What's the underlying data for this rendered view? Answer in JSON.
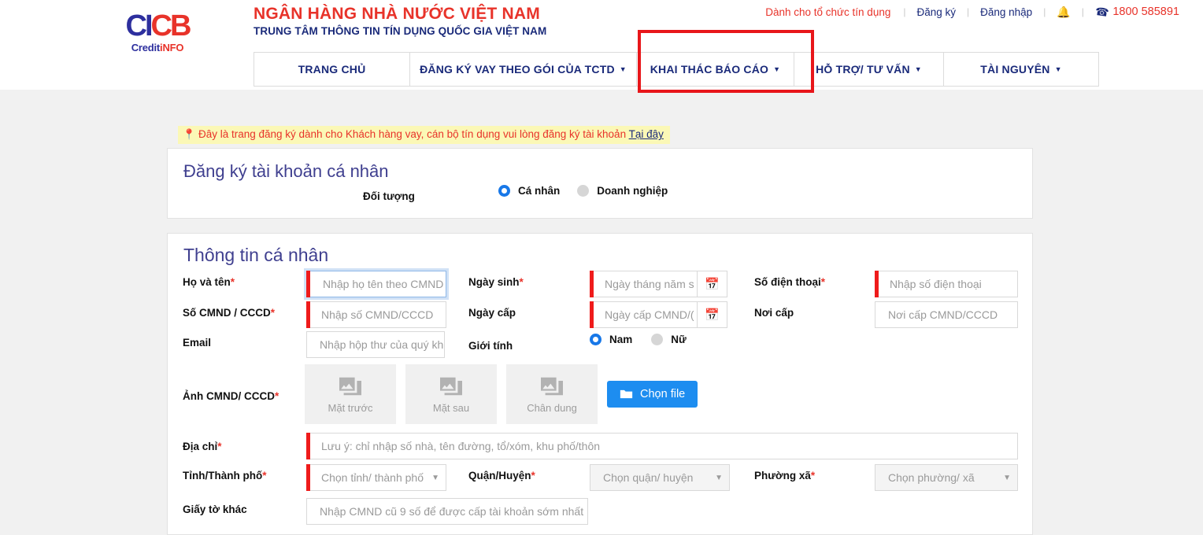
{
  "topbar": {
    "org_link": "Dành cho tổ chức tín dụng",
    "register": "Đăng ký",
    "login": "Đăng nhập",
    "sep": "|",
    "bell_icon": "bell-icon",
    "phone_icon": "phone-icon",
    "phone": "1800 585891"
  },
  "brand": {
    "logo_text": "CICB",
    "logo_sub": "CreditiNFO",
    "title": "NGÂN HÀNG NHÀ NƯỚC VIỆT NAM",
    "subtitle": "TRUNG TÂM THÔNG TIN TÍN DỤNG QUỐC GIA VIỆT NAM"
  },
  "nav": {
    "items": [
      {
        "label": "TRANG CHỦ",
        "caret": false
      },
      {
        "label": "ĐĂNG KÝ VAY THEO GÓI CỦA TCTD",
        "caret": true
      },
      {
        "label": "KHAI THÁC BÁO CÁO",
        "caret": true
      },
      {
        "label": "HỖ TRỢ/ TƯ VẤN",
        "caret": true
      },
      {
        "label": "TÀI NGUYÊN",
        "caret": true
      }
    ],
    "caret_glyph": "▼",
    "highlight_color": "#e8161a",
    "highlighted_item": "KHAI THÁC BÁO CÁO"
  },
  "notice": {
    "pin_icon": "location-pin-icon",
    "text": "Đây là trang đăng ký dành cho Khách hàng vay, cán bộ tín dụng vui lòng đăng ký tài khoản",
    "link": "Tại đây"
  },
  "account_panel": {
    "title": "Đăng ký tài khoản cá nhân",
    "subject_label": "Đối tượng",
    "options": [
      {
        "label": "Cá nhân",
        "selected": true
      },
      {
        "label": "Doanh nghiệp",
        "selected": false
      }
    ]
  },
  "personal_panel": {
    "title": "Thông tin cá nhân",
    "fields": {
      "fullname": {
        "label": "Họ và tên",
        "required": true,
        "placeholder": "Nhập họ tên theo CMND",
        "value": ""
      },
      "idnumber": {
        "label": "Số CMND / CCCD",
        "required": true,
        "placeholder": "Nhập số CMND/CCCD",
        "value": ""
      },
      "email": {
        "label": "Email",
        "required": false,
        "placeholder": "Nhập hộp thư của quý kh",
        "value": ""
      },
      "birthdate": {
        "label": "Ngày sinh",
        "required": true,
        "placeholder": "Ngày tháng năm s",
        "value": ""
      },
      "issuedate": {
        "label": "Ngày cấp",
        "required": false,
        "placeholder": "Ngày cấp CMND/(",
        "value": ""
      },
      "phone": {
        "label": "Số điện thoại",
        "required": true,
        "placeholder": "Nhập số điện thoại",
        "value": ""
      },
      "issueplace": {
        "label": "Nơi cấp",
        "required": false,
        "placeholder": "Nơi cấp CMND/CCCD",
        "value": ""
      },
      "gender": {
        "label": "Giới tính",
        "options": [
          {
            "label": "Nam",
            "selected": true
          },
          {
            "label": "Nữ",
            "selected": false
          }
        ]
      },
      "idphoto": {
        "label": "Ảnh CMND/ CCCD",
        "required": true,
        "boxes": [
          "Mặt trước",
          "Mặt sau",
          "Chân dung"
        ],
        "button": "Chọn file",
        "button_icon": "folder-icon",
        "box_icon": "image-placeholder-icon"
      },
      "address": {
        "label": "Địa chỉ",
        "required": true,
        "placeholder": "Lưu ý: chỉ nhập số nhà, tên đường, tổ/xóm, khu phố/thôn",
        "value": ""
      },
      "province": {
        "label": "Tỉnh/Thành phố",
        "required": true,
        "placeholder": "Chọn tỉnh/ thành phố",
        "value": ""
      },
      "district": {
        "label": "Quận/Huyện",
        "required": true,
        "placeholder": "Chọn quận/ huyện",
        "value": "",
        "disabled": true
      },
      "ward": {
        "label": "Phường xã",
        "required": true,
        "placeholder": "Chọn phường/ xã",
        "value": "",
        "disabled": true
      },
      "otherdocs": {
        "label": "Giấy tờ khác",
        "required": false,
        "placeholder": "Nhập CMND cũ 9 số để được cấp tài khoản sớm nhất",
        "value": ""
      }
    },
    "calendar_icon": "calendar-icon",
    "dropdown_icon": "chevron-down-icon"
  },
  "colors": {
    "brand_red": "#e8332a",
    "brand_blue": "#1a2a7a",
    "accent_blue": "#1d8df0",
    "required_red": "#ef1b1b",
    "panel_title": "#3f3f8f"
  }
}
